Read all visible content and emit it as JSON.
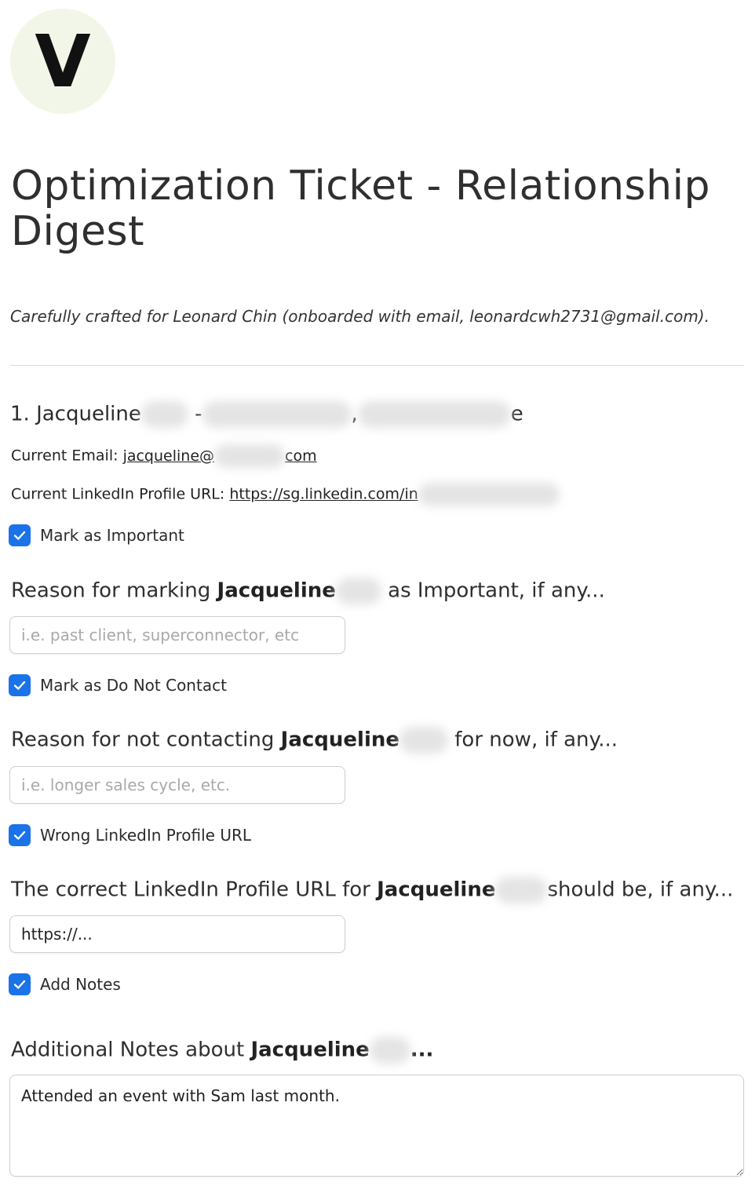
{
  "logo": {
    "letter": "V"
  },
  "title": "Optimization Ticket - Relationship Digest",
  "subtitle": "Carefully crafted for Leonard Chin (onboarded with email, leonardcwh2731@gmail.com).",
  "contact": {
    "heading_prefix": "1. Jacqueline",
    "heading_sep1": "-",
    "heading_sep2": ",",
    "heading_end": "e",
    "email_label": "Current Email: ",
    "email_start": "jacqueline@",
    "email_end": "com",
    "linkedin_label": "Current LinkedIn Profile URL: ",
    "linkedin_start": "https://sg.linkedin.com/in"
  },
  "important": {
    "checkbox_label": "Mark as Important",
    "checked": true,
    "question_prefix": "Reason for marking ",
    "name": "Jacqueline",
    "question_suffix": "as Important, if any...",
    "placeholder": "i.e. past client, superconnector, etc"
  },
  "do_not_contact": {
    "checkbox_label": "Mark as Do Not Contact",
    "checked": true,
    "question_prefix": "Reason for not contacting ",
    "name": "Jacqueline",
    "question_suffix": "for now, if any...",
    "placeholder": "i.e. longer sales cycle, etc."
  },
  "wrong_linkedin": {
    "checkbox_label": "Wrong LinkedIn Profile URL",
    "checked": true,
    "question_prefix": "The correct LinkedIn Profile URL for ",
    "name": "Jacqueline",
    "question_suffix": "should be, if any...",
    "value": "https://..."
  },
  "notes": {
    "checkbox_label": "Add Notes",
    "checked": true,
    "question_prefix": "Additional Notes about ",
    "name": "Jacqueline",
    "question_suffix": "...",
    "value": "Attended an event with Sam last month."
  },
  "colors": {
    "accent": "#1a73e8",
    "logo_bg": "#f2f6e8"
  }
}
